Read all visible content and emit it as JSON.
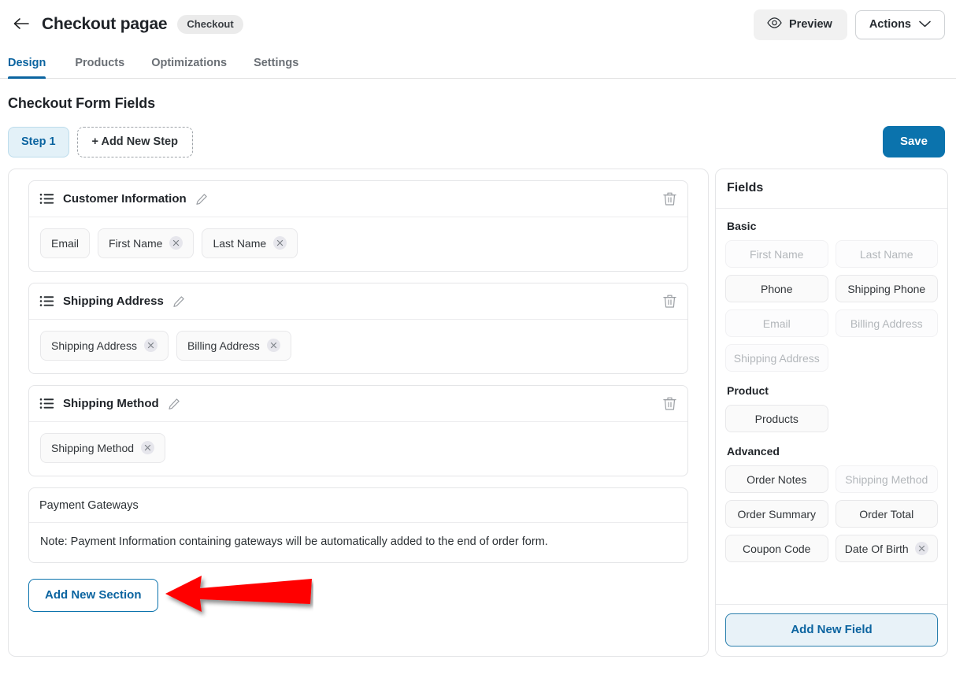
{
  "header": {
    "back_icon": "arrow-left-icon",
    "title": "Checkout pagae",
    "badge": "Checkout",
    "preview_label": "Preview",
    "preview_icon": "eye-icon",
    "actions_label": "Actions",
    "actions_icon": "chevron-down-icon"
  },
  "tabs": [
    {
      "label": "Design",
      "active": true
    },
    {
      "label": "Products",
      "active": false
    },
    {
      "label": "Optimizations",
      "active": false
    },
    {
      "label": "Settings",
      "active": false
    }
  ],
  "page": {
    "form_heading": "Checkout Form Fields",
    "step_chip": "Step 1",
    "add_step": "+ Add New Step",
    "save_label": "Save",
    "add_section_label": "Add New Section",
    "accent_blue": "#0b64a0",
    "save_blue": "#0b73ad",
    "arrow_color": "#ff0000"
  },
  "sections": [
    {
      "title": "Customer Information",
      "has_drag_icon": true,
      "has_edit_icon": true,
      "has_delete_icon": true,
      "chips": [
        {
          "label": "Email",
          "removable": false
        },
        {
          "label": "First Name",
          "removable": true
        },
        {
          "label": "Last Name",
          "removable": true
        }
      ]
    },
    {
      "title": "Shipping Address",
      "has_drag_icon": true,
      "has_edit_icon": true,
      "has_delete_icon": true,
      "chips": [
        {
          "label": "Shipping Address",
          "removable": true
        },
        {
          "label": "Billing Address",
          "removable": true
        }
      ]
    },
    {
      "title": "Shipping Method",
      "has_drag_icon": true,
      "has_edit_icon": true,
      "has_delete_icon": true,
      "chips": [
        {
          "label": "Shipping Method",
          "removable": true
        }
      ]
    }
  ],
  "payment_section": {
    "title": "Payment Gateways",
    "note": "Note: Payment Information containing gateways will be automatically added to the end of order form."
  },
  "fields_panel": {
    "title": "Fields",
    "add_field_label": "Add New Field",
    "groups": [
      {
        "label": "Basic",
        "items": [
          {
            "label": "First Name",
            "disabled": true,
            "removable": false
          },
          {
            "label": "Last Name",
            "disabled": true,
            "removable": false
          },
          {
            "label": "Phone",
            "disabled": false,
            "removable": false
          },
          {
            "label": "Shipping Phone",
            "disabled": false,
            "removable": false
          },
          {
            "label": "Email",
            "disabled": true,
            "removable": false
          },
          {
            "label": "Billing Address",
            "disabled": true,
            "removable": false
          },
          {
            "label": "Shipping Address",
            "disabled": true,
            "removable": false
          }
        ]
      },
      {
        "label": "Product",
        "items": [
          {
            "label": "Products",
            "disabled": false,
            "removable": false
          }
        ]
      },
      {
        "label": "Advanced",
        "items": [
          {
            "label": "Order Notes",
            "disabled": false,
            "removable": false
          },
          {
            "label": "Shipping Method",
            "disabled": true,
            "removable": false
          },
          {
            "label": "Order Summary",
            "disabled": false,
            "removable": false
          },
          {
            "label": "Order Total",
            "disabled": false,
            "removable": false
          },
          {
            "label": "Coupon Code",
            "disabled": false,
            "removable": false
          },
          {
            "label": "Date Of Birth",
            "disabled": false,
            "removable": true
          }
        ]
      }
    ]
  }
}
